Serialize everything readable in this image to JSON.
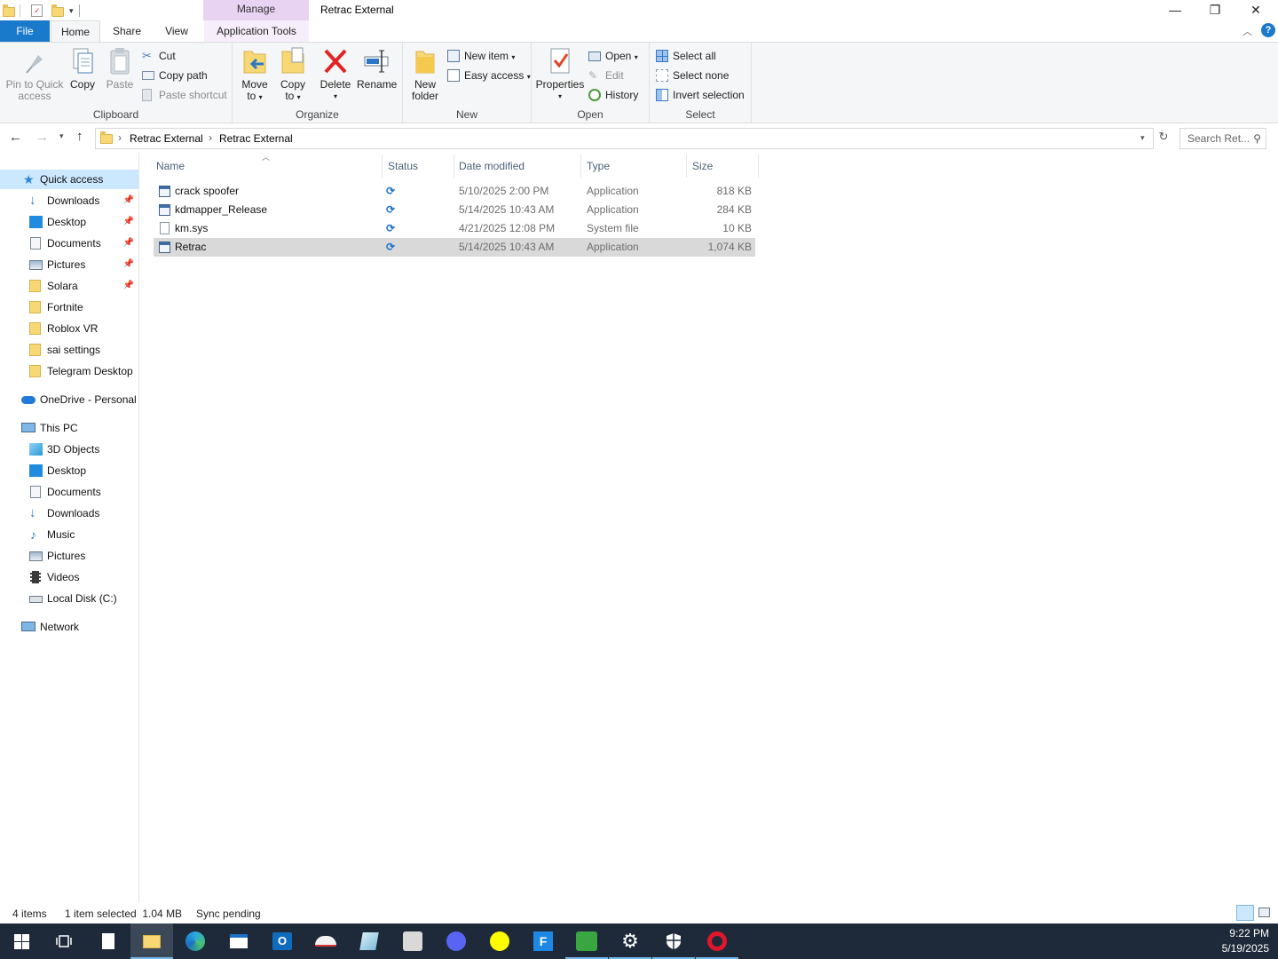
{
  "window": {
    "title": "Retrac External",
    "context_tab": "Manage",
    "controls": {
      "minimize": "—",
      "restore": "❐",
      "close": "✕"
    },
    "help": "?"
  },
  "tabs": {
    "file": "File",
    "home": "Home",
    "share": "Share",
    "view": "View",
    "app_tools": "Application Tools"
  },
  "ribbon": {
    "clipboard": {
      "label": "Clipboard",
      "pin_line1": "Pin to Quick",
      "pin_line2": "access",
      "copy": "Copy",
      "paste": "Paste",
      "cut": "Cut",
      "copy_path": "Copy path",
      "paste_shortcut": "Paste shortcut"
    },
    "organize": {
      "label": "Organize",
      "move_line1": "Move",
      "move_line2": "to",
      "copy_line1": "Copy",
      "copy_line2": "to",
      "delete": "Delete",
      "rename": "Rename"
    },
    "new": {
      "label": "New",
      "folder_line1": "New",
      "folder_line2": "folder",
      "new_item": "New item",
      "easy_access": "Easy access"
    },
    "open": {
      "label": "Open",
      "properties": "Properties",
      "open": "Open",
      "edit": "Edit",
      "history": "History"
    },
    "select": {
      "label": "Select",
      "select_all": "Select all",
      "select_none": "Select none",
      "invert": "Invert selection"
    }
  },
  "address": {
    "path": [
      "Retrac External",
      "Retrac External"
    ],
    "search_placeholder": "Search Ret..."
  },
  "nav": {
    "quick_access": "Quick access",
    "quick_items": [
      {
        "label": "Downloads",
        "icon": "download-icon",
        "pinned": true
      },
      {
        "label": "Desktop",
        "icon": "desktop-icon",
        "pinned": true
      },
      {
        "label": "Documents",
        "icon": "documents-icon",
        "pinned": true
      },
      {
        "label": "Pictures",
        "icon": "pictures-icon",
        "pinned": true
      },
      {
        "label": "Solara",
        "icon": "folder-icon",
        "pinned": true
      },
      {
        "label": "Fortnite",
        "icon": "folder-icon",
        "pinned": false
      },
      {
        "label": "Roblox VR",
        "icon": "folder-icon",
        "pinned": false
      },
      {
        "label": "sai settings",
        "icon": "folder-icon",
        "pinned": false
      },
      {
        "label": "Telegram Desktop",
        "icon": "folder-icon",
        "pinned": false
      }
    ],
    "onedrive": "OneDrive - Personal",
    "this_pc": "This PC",
    "pc_items": [
      "3D Objects",
      "Desktop",
      "Documents",
      "Downloads",
      "Music",
      "Pictures",
      "Videos",
      "Local Disk (C:)"
    ],
    "network": "Network"
  },
  "columns": {
    "name": "Name",
    "status": "Status",
    "date": "Date modified",
    "type": "Type",
    "size": "Size"
  },
  "files": [
    {
      "name": "crack spoofer",
      "date": "5/10/2025 2:00 PM",
      "type": "Application",
      "size": "818 KB",
      "selected": false
    },
    {
      "name": "kdmapper_Release",
      "date": "5/14/2025 10:43 AM",
      "type": "Application",
      "size": "284 KB",
      "selected": false
    },
    {
      "name": "km.sys",
      "date": "4/21/2025 12:08 PM",
      "type": "System file",
      "size": "10 KB",
      "selected": false
    },
    {
      "name": "Retrac",
      "date": "5/14/2025 10:43 AM",
      "type": "Application",
      "size": "1,074 KB",
      "selected": true
    }
  ],
  "status": {
    "count": "4 items",
    "selected": "1 item selected  1.04 MB",
    "sync": "Sync pending"
  },
  "clock": {
    "time": "9:22 PM",
    "date": "5/19/2025"
  },
  "colors": {
    "accent": "#1979ca",
    "manage_tab": "#e8d3f2",
    "taskbar": "#1e2a3a",
    "sync_blue": "#1e73c8"
  }
}
